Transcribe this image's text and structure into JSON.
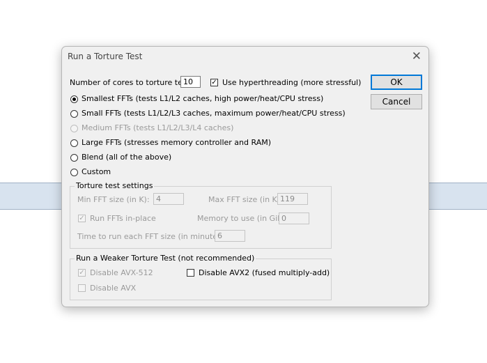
{
  "dialog": {
    "title": "Run a Torture Test",
    "close_glyph": "✕"
  },
  "cores": {
    "label": "Number of cores to torture test:",
    "value": "10",
    "hyperthreading_label": "Use hyperthreading (more stressful)",
    "hyperthreading_checked": true
  },
  "tests": [
    {
      "label": "Smallest FFTs (tests L1/L2 caches, high power/heat/CPU stress)",
      "selected": true,
      "enabled": true
    },
    {
      "label": "Small FFTs (tests L1/L2/L3 caches, maximum power/heat/CPU stress)",
      "selected": false,
      "enabled": true
    },
    {
      "label": "Medium FFTs (tests L1/L2/L3/L4 caches)",
      "selected": false,
      "enabled": false
    },
    {
      "label": "Large FFTs (stresses memory controller and RAM)",
      "selected": false,
      "enabled": true
    },
    {
      "label": "Blend (all of the above)",
      "selected": false,
      "enabled": true
    },
    {
      "label": "Custom",
      "selected": false,
      "enabled": true
    }
  ],
  "settings": {
    "title": "Torture test settings",
    "min_fft_label": "Min FFT size (in K):",
    "min_fft_value": "4",
    "max_fft_label": "Max FFT size (in K):",
    "max_fft_value": "119",
    "inplace_label": "Run FFTs in-place",
    "inplace_checked": true,
    "memory_label": "Memory to use (in GiB):",
    "memory_value": "0",
    "time_label": "Time to run each FFT size (in minutes):",
    "time_value": "6"
  },
  "weaker": {
    "title": "Run a Weaker Torture Test (not recommended)",
    "avx512_label": "Disable AVX-512",
    "avx512_checked": true,
    "avx2_label": "Disable AVX2 (fused multiply-add)",
    "avx2_checked": false,
    "avx_label": "Disable AVX",
    "avx_checked": false
  },
  "buttons": {
    "ok": "OK",
    "cancel": "Cancel"
  },
  "colors": {
    "accent": "#0078d7",
    "dialog_bg": "#f0f0f0",
    "disabled_text": "#9a9a9a"
  }
}
